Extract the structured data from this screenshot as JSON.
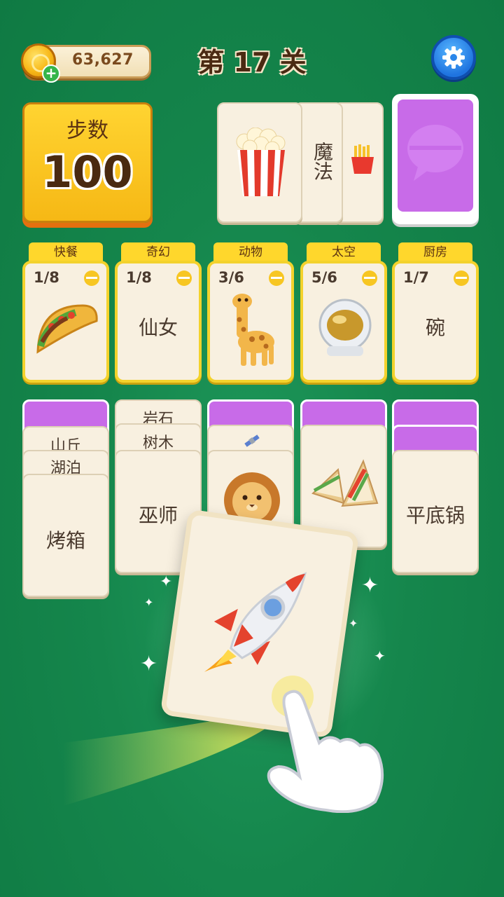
{
  "header": {
    "coins": "63,627",
    "coin_plus": "+",
    "level_title": "第 17 关"
  },
  "steps": {
    "label": "步数",
    "value": "100"
  },
  "open_cards": {
    "card_1_icon": "popcorn-icon",
    "card_2_text": "魔法",
    "card_3_icon": "fries-icon"
  },
  "categories": [
    {
      "name": "快餐",
      "count": "1/8",
      "icon": "taco-icon"
    },
    {
      "name": "奇幻",
      "count": "1/8",
      "text": "仙女"
    },
    {
      "name": "动物",
      "count": "3/6",
      "icon": "giraffe-icon"
    },
    {
      "name": "太空",
      "count": "5/6",
      "icon": "astronaut-helmet-icon"
    },
    {
      "name": "厨房",
      "count": "1/7",
      "text": "碗"
    }
  ],
  "piles": {
    "col1": {
      "strip1": "山丘",
      "strip2": "湖泊",
      "top": "烤箱"
    },
    "col2": {
      "strip1": "岩石",
      "strip2": "树木",
      "top": "巫师"
    },
    "col3": {
      "strip_icon": "satellite-icon",
      "top_icon": "lion-icon"
    },
    "col4": {
      "top_icon": "sandwich-icon"
    },
    "col5": {
      "top": "平底锅"
    }
  },
  "dragged_card": {
    "icon": "rocket-icon"
  },
  "colors": {
    "background": "#15864c",
    "slot_border": "#f3d22c",
    "hidden_card": "#c86be8",
    "steps_panel": "#ffd431"
  }
}
